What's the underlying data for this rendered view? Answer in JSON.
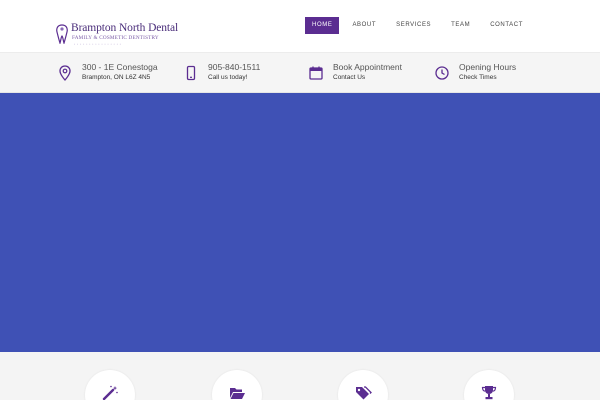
{
  "header": {
    "logo": {
      "title": "Brampton North Dental",
      "subtitle": "FAMILY & COSMETIC DENTISTRY"
    },
    "nav": [
      {
        "label": "HOME",
        "active": true
      },
      {
        "label": "ABOUT",
        "active": false
      },
      {
        "label": "SERVICES",
        "active": false
      },
      {
        "label": "TEAM",
        "active": false
      },
      {
        "label": "CONTACT",
        "active": false
      }
    ]
  },
  "infobar": [
    {
      "icon": "map-pin-icon",
      "title": "300 - 1E Conestoga",
      "sub": "Brampton, ON L6Z 4N5"
    },
    {
      "icon": "mobile-phone-icon",
      "title": "905-840-1511",
      "sub": "Call us today!"
    },
    {
      "icon": "calendar-icon",
      "title": "Book Appointment",
      "sub": "Contact Us"
    },
    {
      "icon": "clock-icon",
      "title": "Opening Hours",
      "sub": "Check Times"
    }
  ],
  "hero": {
    "background": "#3f51b5"
  },
  "features": [
    {
      "icon": "magic-wand-icon"
    },
    {
      "icon": "folder-open-icon"
    },
    {
      "icon": "tags-icon"
    },
    {
      "icon": "trophy-icon"
    }
  ],
  "colors": {
    "brand": "#5b2d91",
    "hero": "#3f51b5",
    "infobar": "#f5f5f5"
  }
}
